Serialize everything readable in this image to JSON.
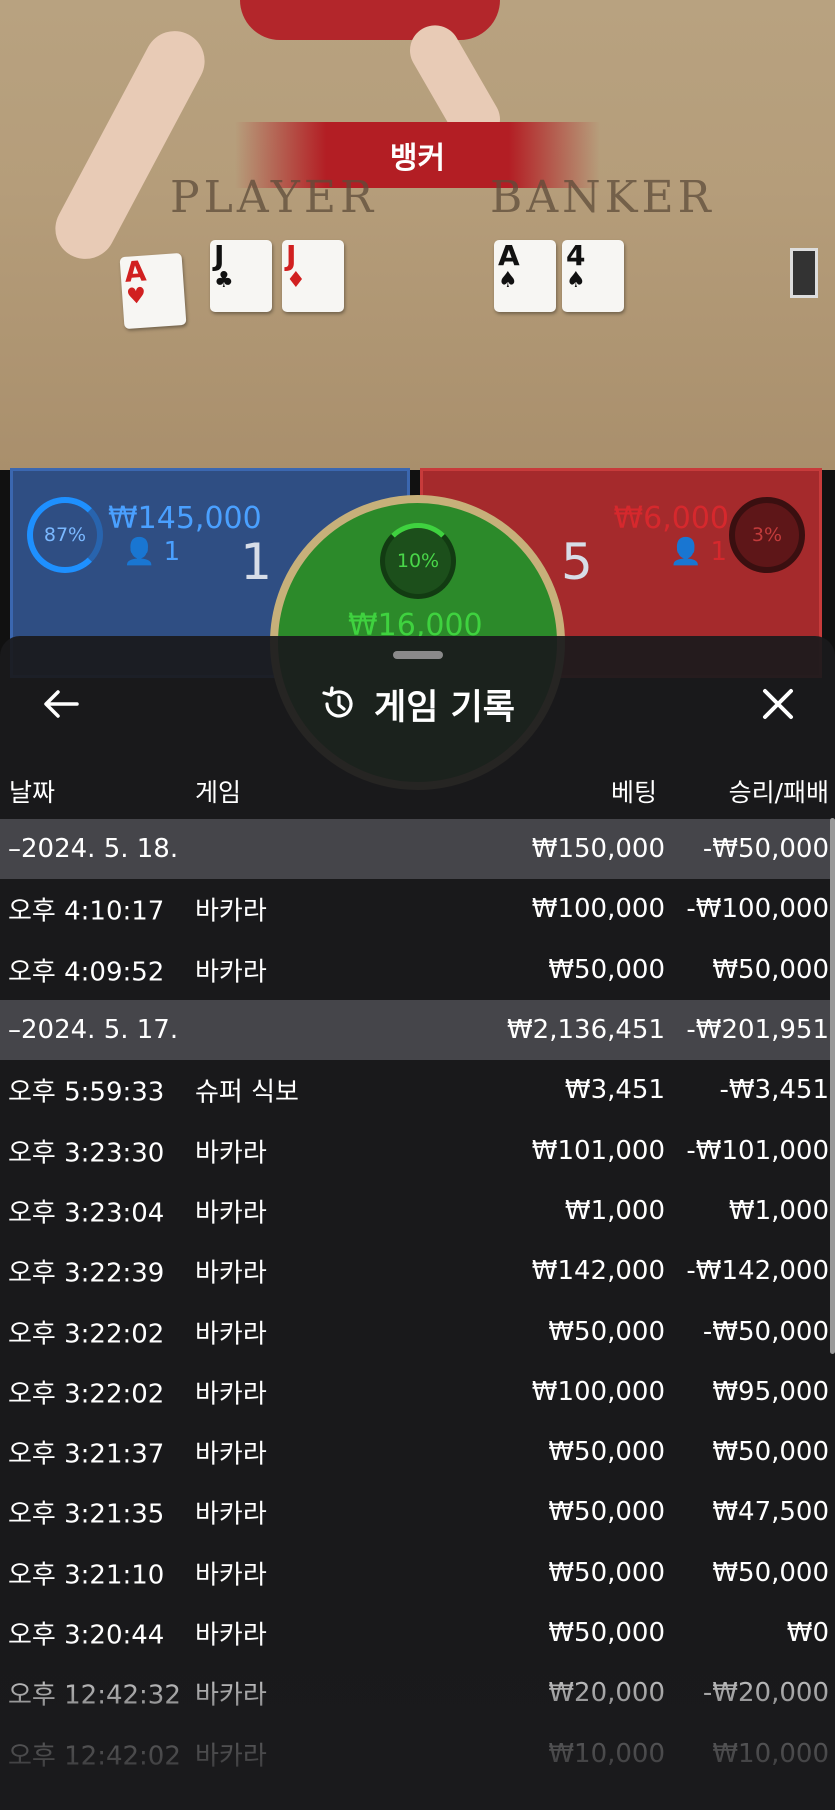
{
  "scene": {
    "result_banner": "뱅커",
    "player_word": "PLAYER",
    "banker_word": "BANKER",
    "player_cards": [
      {
        "rank": "A",
        "suit": "♥",
        "color": "red"
      },
      {
        "rank": "J",
        "suit": "♣",
        "color": "black"
      },
      {
        "rank": "J",
        "suit": "♦",
        "color": "red"
      }
    ],
    "banker_cards": [
      {
        "rank": "A",
        "suit": "♠",
        "color": "black"
      },
      {
        "rank": "4",
        "suit": "♠",
        "color": "black"
      }
    ],
    "player_bet": {
      "percent": "87%",
      "amount": "₩145,000",
      "count": "1",
      "score": "1"
    },
    "banker_bet": {
      "percent": "3%",
      "amount": "₩6,000",
      "count": "1",
      "score": "5"
    },
    "tie_bet": {
      "percent": "10%",
      "amount": "₩16,000"
    },
    "colors": {
      "player": "#2f4e83",
      "banker": "#a52a2c",
      "tie": "#2c8a2a"
    }
  },
  "sheet": {
    "title": "게임 기록",
    "title_icon": "history-icon",
    "back_icon": "arrow-left-icon",
    "close_icon": "close-icon",
    "columns": {
      "date": "날짜",
      "game": "게임",
      "bet": "베팅",
      "win": "승리/패배"
    },
    "rows": [
      {
        "type": "group",
        "date": "–2024. 5. 18.",
        "game": "",
        "bet": "₩150,000",
        "win": "-₩50,000"
      },
      {
        "type": "item",
        "date": "오후 4:10:17",
        "game": "바카라",
        "bet": "₩100,000",
        "win": "-₩100,000"
      },
      {
        "type": "item",
        "date": "오후 4:09:52",
        "game": "바카라",
        "bet": "₩50,000",
        "win": "₩50,000"
      },
      {
        "type": "group",
        "date": "–2024. 5. 17.",
        "game": "",
        "bet": "₩2,136,451",
        "win": "-₩201,951"
      },
      {
        "type": "item",
        "date": "오후 5:59:33",
        "game": "슈퍼 식보",
        "bet": "₩3,451",
        "win": "-₩3,451"
      },
      {
        "type": "item",
        "date": "오후 3:23:30",
        "game": "바카라",
        "bet": "₩101,000",
        "win": "-₩101,000"
      },
      {
        "type": "item",
        "date": "오후 3:23:04",
        "game": "바카라",
        "bet": "₩1,000",
        "win": "₩1,000"
      },
      {
        "type": "item",
        "date": "오후 3:22:39",
        "game": "바카라",
        "bet": "₩142,000",
        "win": "-₩142,000"
      },
      {
        "type": "item",
        "date": "오후 3:22:02",
        "game": "바카라",
        "bet": "₩50,000",
        "win": "-₩50,000"
      },
      {
        "type": "item",
        "date": "오후 3:22:02",
        "game": "바카라",
        "bet": "₩100,000",
        "win": "₩95,000"
      },
      {
        "type": "item",
        "date": "오후 3:21:37",
        "game": "바카라",
        "bet": "₩50,000",
        "win": "₩50,000"
      },
      {
        "type": "item",
        "date": "오후 3:21:35",
        "game": "바카라",
        "bet": "₩50,000",
        "win": "₩47,500"
      },
      {
        "type": "item",
        "date": "오후 3:21:10",
        "game": "바카라",
        "bet": "₩50,000",
        "win": "₩50,000"
      },
      {
        "type": "item",
        "date": "오후 3:20:44",
        "game": "바카라",
        "bet": "₩50,000",
        "win": "₩0"
      },
      {
        "type": "item",
        "date": "오후 12:42:32",
        "game": "바카라",
        "bet": "₩20,000",
        "win": "-₩20,000"
      },
      {
        "type": "item",
        "date": "오후 12:42:02",
        "game": "바카라",
        "bet": "₩10,000",
        "win": "₩10,000"
      }
    ]
  }
}
